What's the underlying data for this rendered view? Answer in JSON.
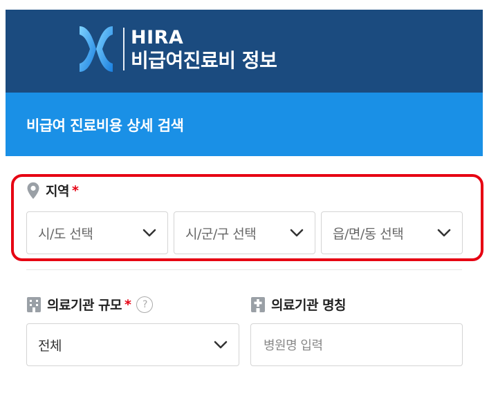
{
  "header": {
    "logo_title": "HIRA",
    "logo_subtitle": "비급여진료비 정보",
    "page_title": "비급여 진료비용 상세 검색"
  },
  "region": {
    "label": "지역",
    "required_mark": "*",
    "sido": "시/도 선택",
    "sigungu": "시/군/구 선택",
    "eupmyeondong": "읍/면/동 선택"
  },
  "institution_size": {
    "label": "의료기관 규모",
    "required_mark": "*",
    "help": "?",
    "value": "전체"
  },
  "institution_name": {
    "label": "의료기관 명칭",
    "placeholder": "병원명 입력"
  },
  "colors": {
    "header_dark": "#1b4b7f",
    "header_blue": "#1a90e6",
    "highlight_red": "#e60012"
  }
}
